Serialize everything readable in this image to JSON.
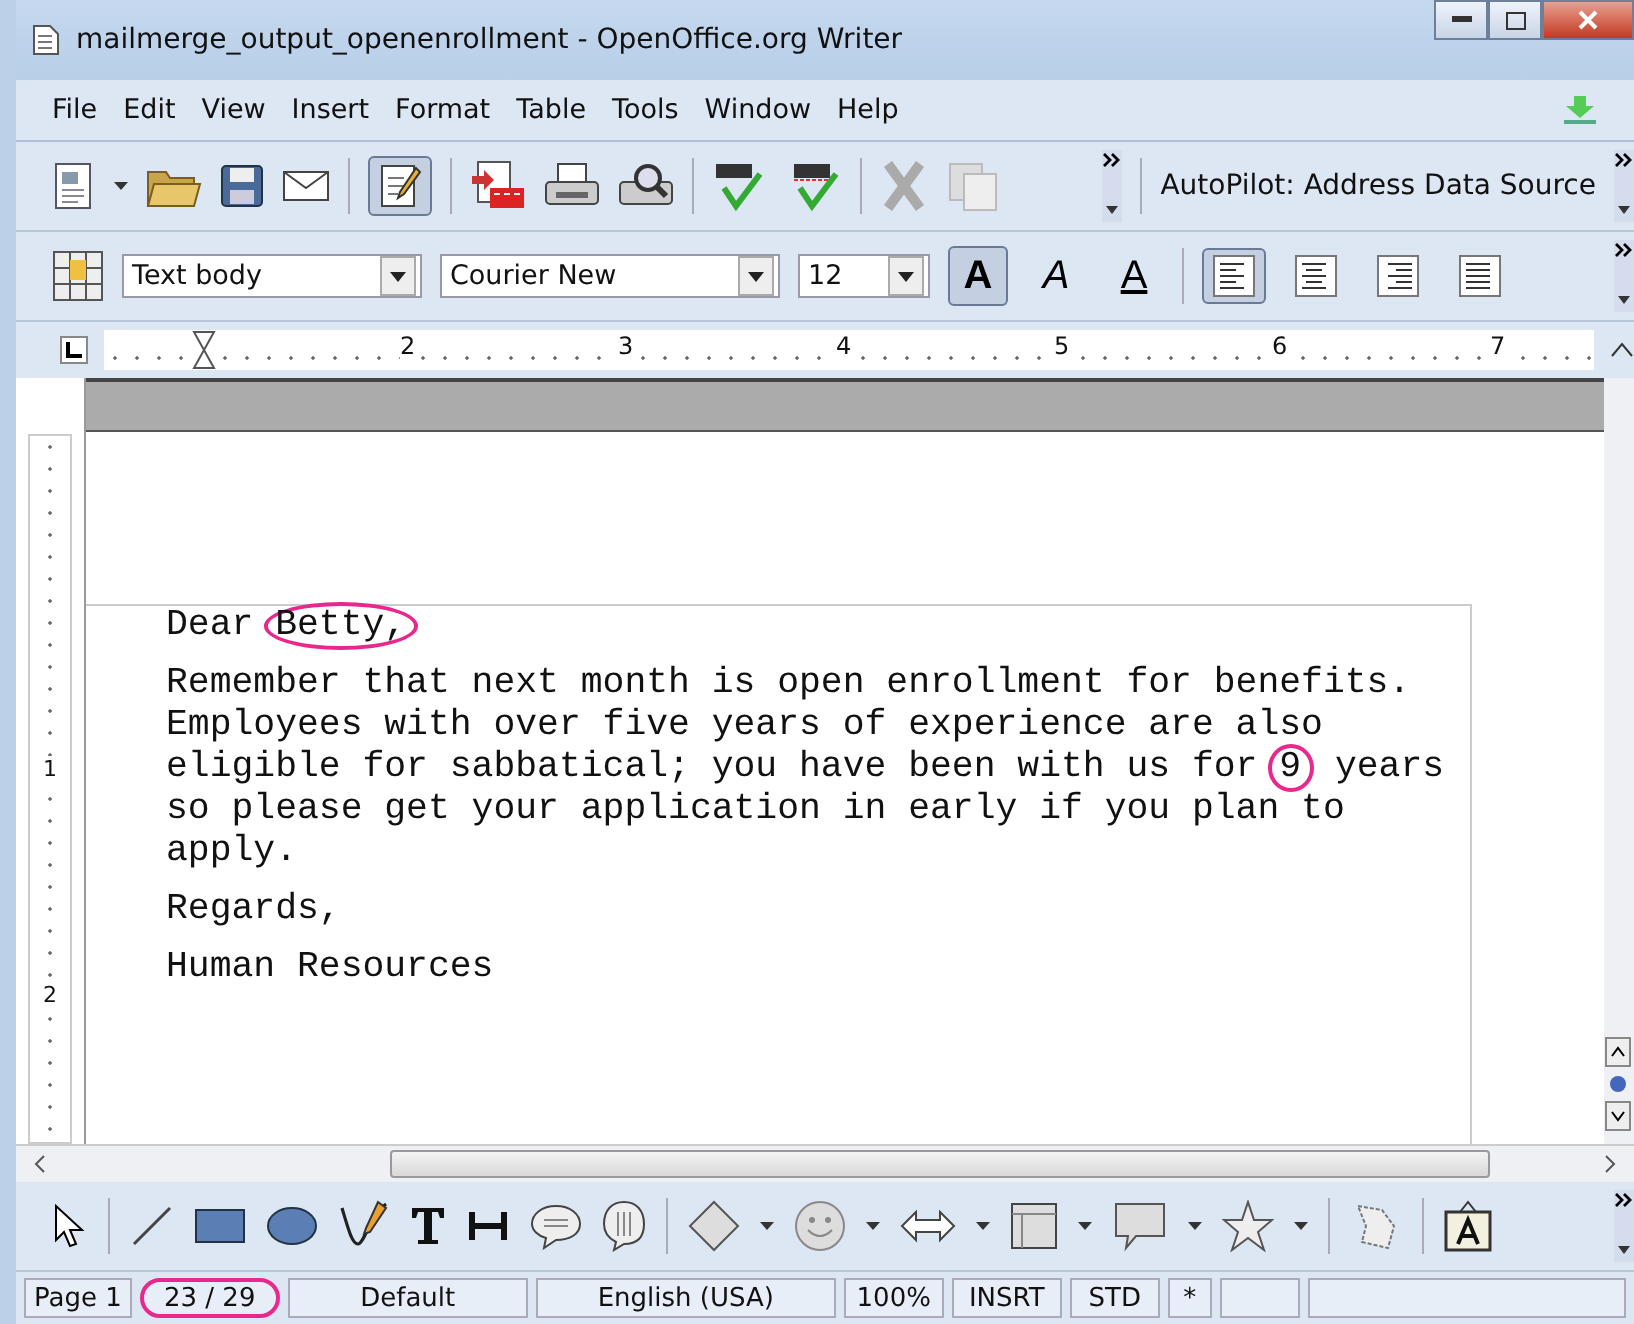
{
  "window": {
    "title": "mailmerge_output_openenrollment - OpenOffice.org Writer"
  },
  "menu": [
    "File",
    "Edit",
    "View",
    "Insert",
    "Format",
    "Table",
    "Tools",
    "Window",
    "Help"
  ],
  "autopilot": {
    "label": "AutoPilot: Address Data Source"
  },
  "formatting": {
    "style": "Text body",
    "font": "Courier New",
    "size": "12"
  },
  "format_toggles": [
    {
      "kind": "bold",
      "label": "A",
      "selected": true
    },
    {
      "kind": "italic",
      "label": "A",
      "selected": false
    },
    {
      "kind": "underline",
      "label": "A",
      "selected": false
    }
  ],
  "align_buttons": [
    {
      "kind": "left",
      "selected": true
    },
    {
      "kind": "center",
      "selected": false
    },
    {
      "kind": "right",
      "selected": false
    },
    {
      "kind": "justify",
      "selected": false
    }
  ],
  "ruler": {
    "marks": [
      "2",
      "3",
      "4",
      "5",
      "6",
      "7"
    ]
  },
  "vertical_ruler": {
    "marks": [
      "1",
      "2"
    ]
  },
  "letter": [
    [
      [
        {
          "text": "Dear ",
          "circled": false
        },
        {
          "text": "Betty,",
          "circled": true
        }
      ]
    ],
    [
      [
        {
          "text": "Remember that next month is open enrollment for benefits.",
          "circled": false
        }
      ],
      [
        {
          "text": "Employees with over five years of experience are also",
          "circled": false
        }
      ],
      [
        {
          "text": "eligible for sabbatical; you have been with us for ",
          "circled": false
        },
        {
          "text": "9",
          "circled": true
        },
        {
          "text": " years",
          "circled": false
        }
      ],
      [
        {
          "text": "so please get your application in early if you plan to",
          "circled": false
        }
      ],
      [
        {
          "text": "apply.",
          "circled": false
        }
      ]
    ],
    [
      [
        {
          "text": "Regards,",
          "circled": false
        }
      ]
    ],
    [
      [
        {
          "text": "Human Resources",
          "circled": false
        }
      ]
    ]
  ],
  "status_bar": [
    {
      "text": "Page 1",
      "circled": false
    },
    {
      "text": "23 / 29",
      "circled": true
    },
    {
      "text": "Default",
      "circled": false
    },
    {
      "text": "English (USA)",
      "circled": false
    },
    {
      "text": "100%",
      "circled": false
    },
    {
      "text": "INSRT",
      "circled": false
    },
    {
      "text": "STD",
      "circled": false
    },
    {
      "text": "*",
      "circled": false
    }
  ]
}
